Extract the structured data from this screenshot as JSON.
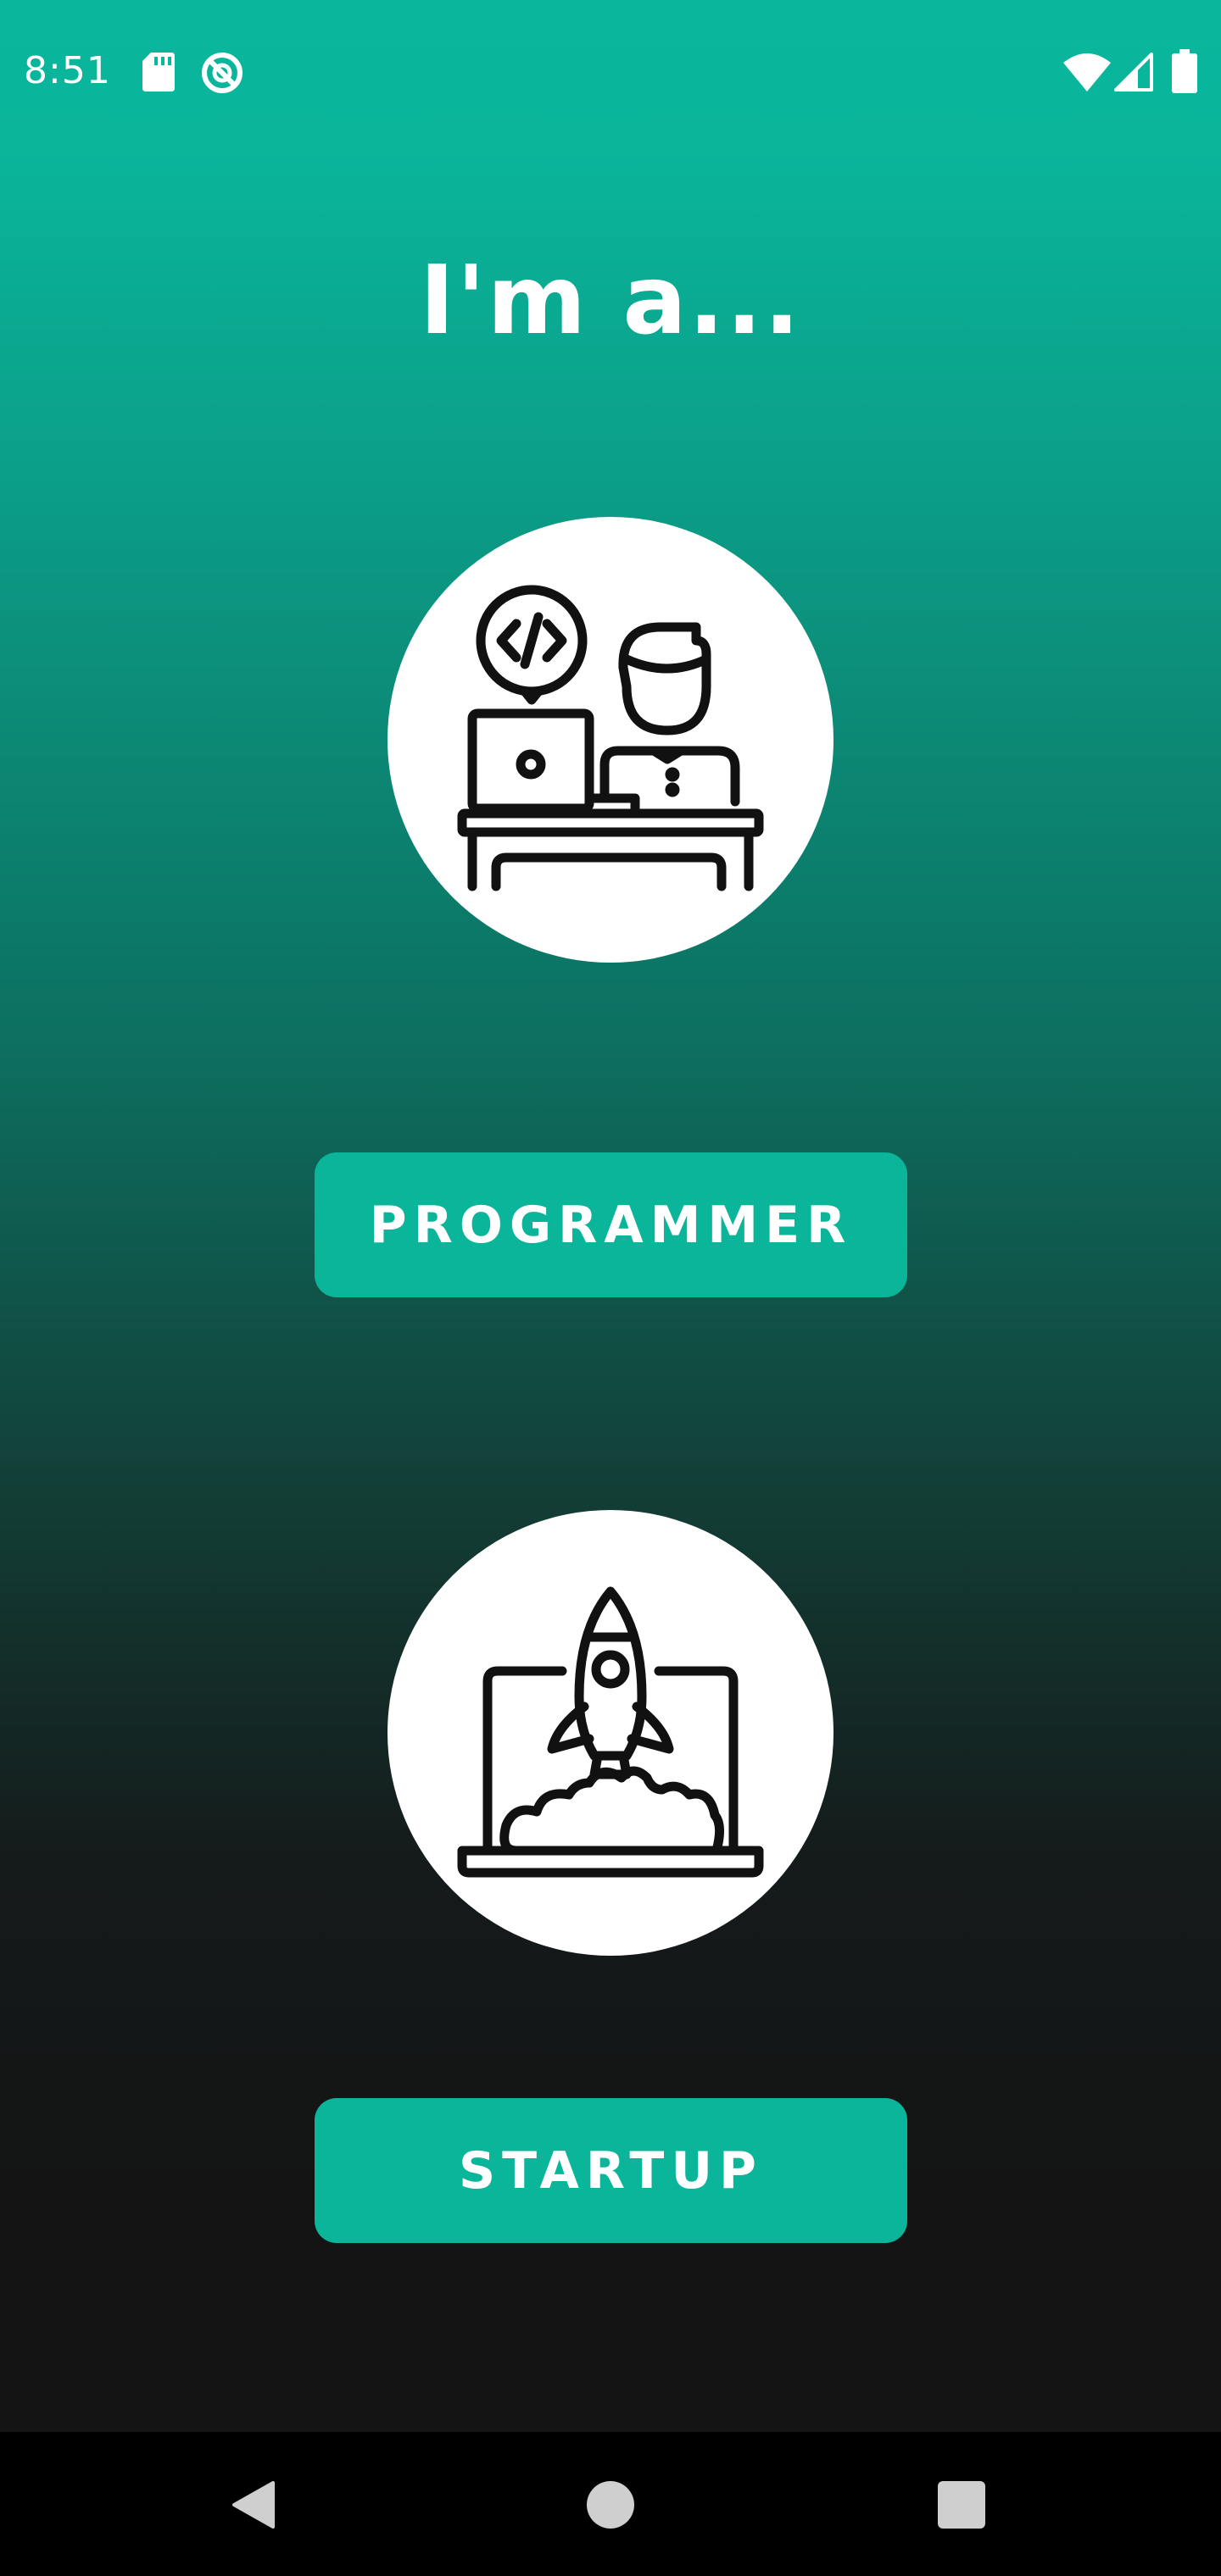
{
  "status_bar": {
    "time": "8:51",
    "icons": [
      "sd-card-icon",
      "sync-icon",
      "wifi-icon",
      "cell-signal-icon",
      "battery-icon"
    ]
  },
  "title": "I'm a...",
  "roles": [
    {
      "icon": "programmer-icon",
      "label": "PROGRAMMER"
    },
    {
      "icon": "rocket-launch-icon",
      "label": "STARTUP"
    }
  ],
  "nav_bar": {
    "icons": [
      "back-icon",
      "home-icon",
      "recents-icon"
    ]
  },
  "colors": {
    "accent": "#0bb59a",
    "gradient_top": "#0ab79c",
    "gradient_bottom": "#141414",
    "nav_bar": "#000000"
  }
}
